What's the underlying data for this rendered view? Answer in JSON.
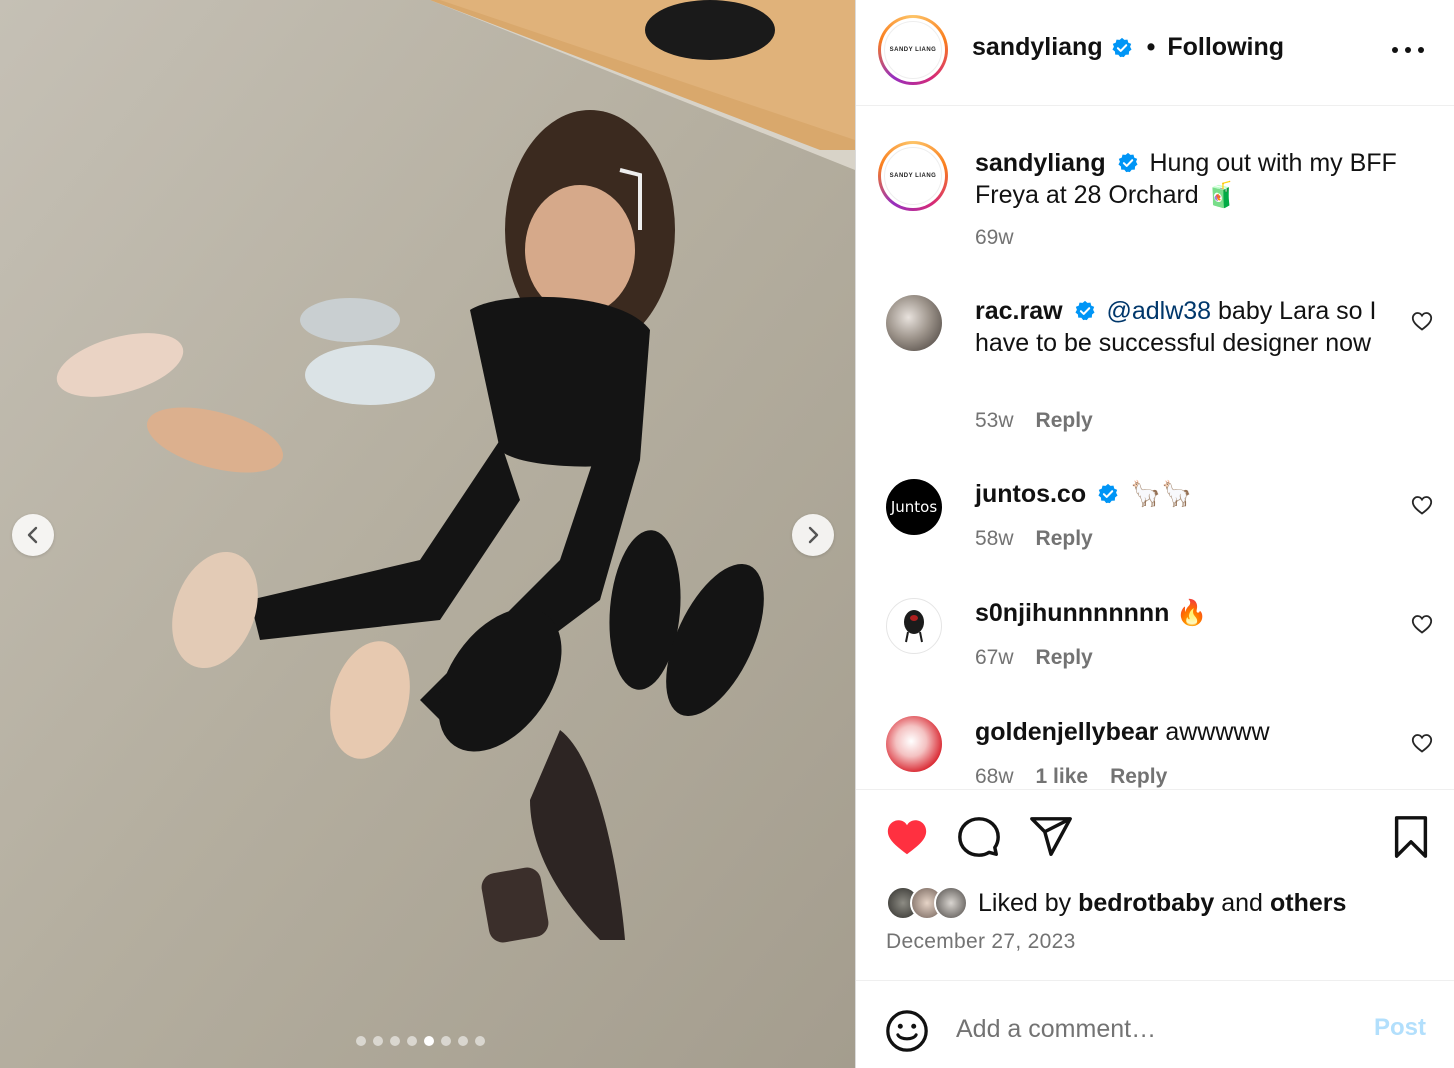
{
  "post": {
    "username": "sandyliang",
    "brand_logo_text": "SANDY LIANG",
    "separator": "•",
    "follow_status": "Following",
    "caption": "Hung out with my BFF Freya at 28 Orchard 🧃",
    "caption_age": "69w"
  },
  "carousel": {
    "slide_count": 8,
    "active_index": 4
  },
  "comments": [
    {
      "username": "rac.raw",
      "verified": true,
      "mention": "@adlw38",
      "text": " baby Lara so I have to be successful designer now",
      "age": "53w",
      "likes": "",
      "reply": "Reply"
    },
    {
      "username": "juntos.co",
      "verified": true,
      "avatar_text": "Juntos",
      "text": "🦙🦙",
      "age": "58w",
      "likes": "",
      "reply": "Reply"
    },
    {
      "username": "s0njihunnnnnnn",
      "verified": false,
      "text": "🔥",
      "age": "67w",
      "likes": "",
      "reply": "Reply"
    },
    {
      "username": "goldenjellybear",
      "verified": false,
      "text": "awwwww",
      "age": "68w",
      "likes": "1 like",
      "reply": "Reply"
    }
  ],
  "likes": {
    "prefix": "Liked by",
    "user": "bedrotbaby",
    "conjunction": "and",
    "others": "others"
  },
  "date": "December 27, 2023",
  "comment_box": {
    "placeholder": "Add a comment…",
    "post_label": "Post"
  },
  "colors": {
    "like_red": "#ff3040",
    "verified_blue": "#0095f6",
    "mention_blue": "#00376b",
    "muted_text": "#737373",
    "post_button_disabled": "#b2dffc"
  },
  "icons": {
    "liked": "heart-filled-icon",
    "comment": "comment-icon",
    "share": "share-icon",
    "save": "bookmark-icon",
    "emoji": "emoji-icon",
    "more": "more-options-icon"
  }
}
